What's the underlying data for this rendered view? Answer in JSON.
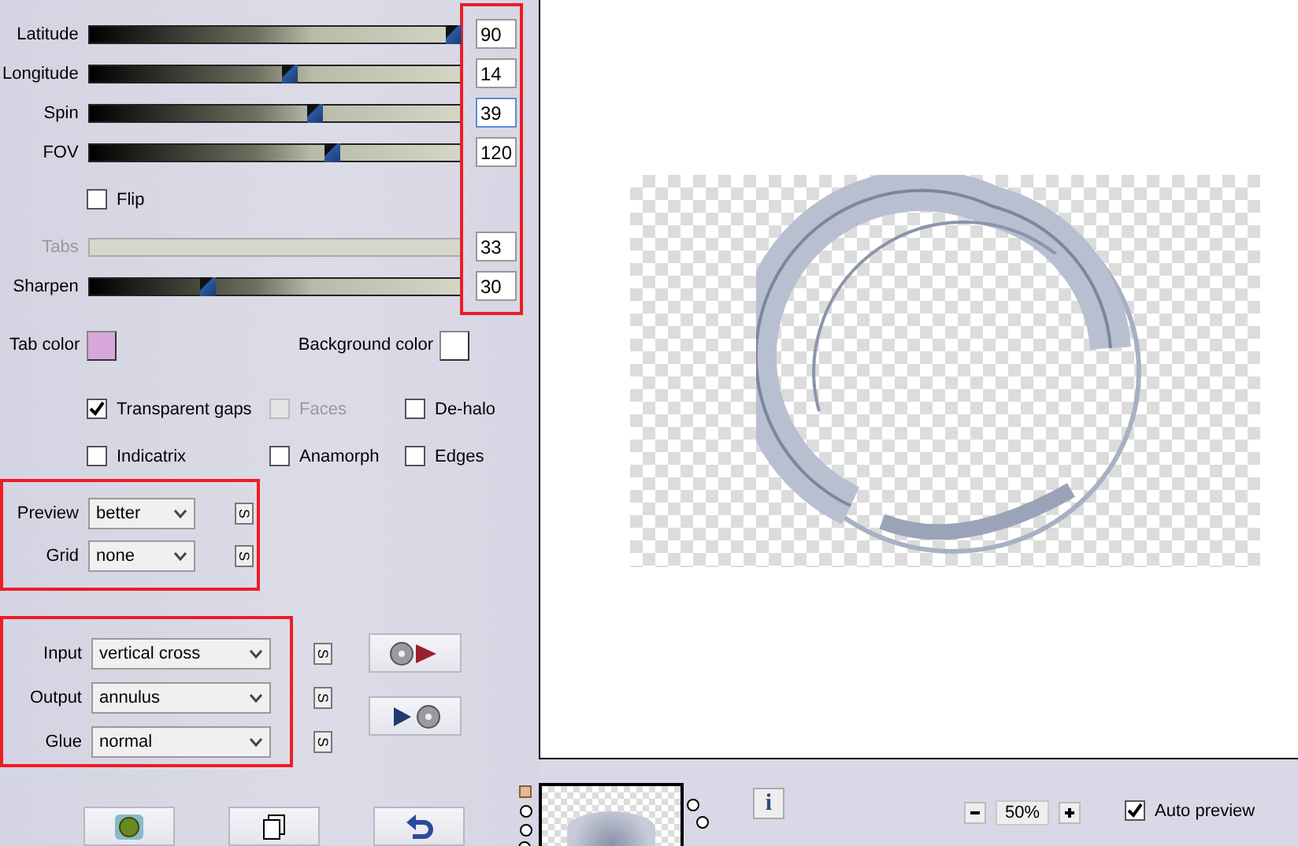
{
  "parameters": {
    "highlighted": true,
    "rows": [
      {
        "kind": "slider",
        "label": "Latitude",
        "level": 1,
        "value": "90",
        "focused": false
      },
      {
        "kind": "slider",
        "label": "Longitude",
        "level": 0.54,
        "value": "14",
        "focused": false
      },
      {
        "kind": "slider",
        "label": "Spin",
        "level": 0.61,
        "value": "39",
        "focused": true
      },
      {
        "kind": "slider",
        "label": "FOV",
        "level": 0.66,
        "value": "120",
        "focused": false
      },
      {
        "kind": "checkbox",
        "label": "Flip",
        "checked": false
      },
      {
        "kind": "slider",
        "label": "Tabs",
        "value": "33",
        "disabled": true,
        "focused": false
      },
      {
        "kind": "slider",
        "label": "Sharpen",
        "level": 0.31,
        "value": "30",
        "focused": false
      }
    ]
  },
  "colors": [
    {
      "label": "Tab color",
      "color": "#d8a8dc"
    },
    {
      "label": "Background color",
      "color": "#ffffff"
    }
  ],
  "options": [
    {
      "label": "Transparent gaps",
      "checked": true,
      "disabled": false
    },
    {
      "label": "Faces",
      "checked": false,
      "disabled": true
    },
    {
      "label": "De-halo",
      "checked": false,
      "disabled": false
    },
    {
      "label": "Indicatrix",
      "checked": false,
      "disabled": false
    },
    {
      "label": "Anamorph",
      "checked": false,
      "disabled": false
    },
    {
      "label": "Edges",
      "checked": false,
      "disabled": false
    }
  ],
  "view_settings": {
    "highlighted": true,
    "dropdowns": [
      {
        "label": "Preview",
        "value": "better",
        "s_button": "S"
      },
      {
        "label": "Grid",
        "value": "none",
        "s_button": "S"
      }
    ]
  },
  "mapping": {
    "highlighted": true,
    "dropdowns": [
      {
        "label": "Input",
        "value": "vertical cross",
        "s_button": "S"
      },
      {
        "label": "Output",
        "value": "annulus",
        "s_button": "S"
      },
      {
        "label": "Glue",
        "value": "normal",
        "s_button": "S"
      }
    ]
  },
  "info_button": "i",
  "zoom": {
    "value": "50%"
  },
  "auto_preview": {
    "label": "Auto preview",
    "checked": true
  }
}
